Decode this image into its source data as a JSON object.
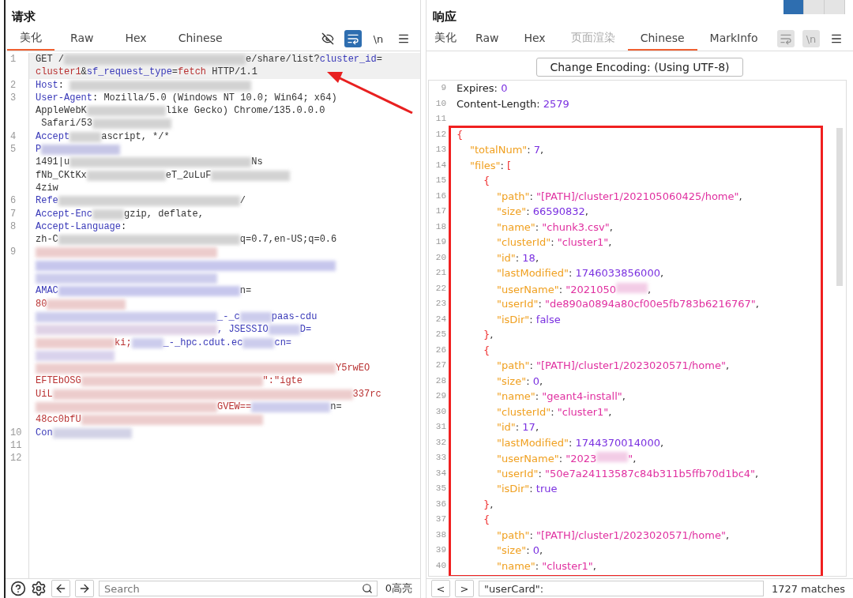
{
  "request": {
    "title": "请求",
    "tabs": [
      {
        "label": "美化",
        "selected": true,
        "disabled": false
      },
      {
        "label": "Raw",
        "selected": false,
        "disabled": false
      },
      {
        "label": "Hex",
        "selected": false,
        "disabled": false
      },
      {
        "label": "Chinese",
        "selected": false,
        "disabled": false
      }
    ],
    "toolbar": {
      "hide_on": false,
      "wrap_on": true,
      "newline_label": "\\n",
      "newline_on": false
    },
    "rows": [
      {
        "no": "1",
        "current": true,
        "segs": [
          {
            "kind": "plain",
            "text": "GET /"
          },
          {
            "kind": "blur-long",
            "color": "#c8c8c8"
          },
          {
            "kind": "plain",
            "text": "e/share/list?"
          },
          {
            "kind": "key",
            "text": "cluster_id"
          },
          {
            "kind": "plain",
            "text": "="
          }
        ]
      },
      {
        "current": true,
        "segs": [
          {
            "kind": "val",
            "text": "cluster1"
          },
          {
            "kind": "plain",
            "text": "&"
          },
          {
            "kind": "key",
            "text": "sf_request_type"
          },
          {
            "kind": "plain",
            "text": "="
          },
          {
            "kind": "val",
            "text": "fetch"
          },
          {
            "kind": "plain",
            "text": " HTTP/1.1"
          }
        ]
      },
      {
        "no": "2",
        "current": false,
        "segs": [
          {
            "kind": "key",
            "text": "Host"
          },
          {
            "kind": "plain",
            "text": ": "
          },
          {
            "kind": "blur-long",
            "color": "#c8c8c8"
          }
        ]
      },
      {
        "no": "3",
        "current": false,
        "segs": [
          {
            "kind": "key",
            "text": "User-Agent"
          },
          {
            "kind": "plain",
            "text": ": Mozilla/5.0 (Windows NT 10.0; Win64; x64)"
          }
        ]
      },
      {
        "current": false,
        "segs": [
          {
            "kind": "plain",
            "text": "AppleWebK"
          },
          {
            "kind": "blur-medium",
            "color": "#c8c8c8"
          },
          {
            "kind": "plain",
            "text": "like Gecko) Chrome/135.0.0.0"
          }
        ]
      },
      {
        "current": false,
        "segs": [
          {
            "kind": "plain",
            "text": " Safari/53"
          },
          {
            "kind": "blur-medium",
            "color": "#c8c8c8"
          }
        ]
      },
      {
        "no": "4",
        "current": false,
        "segs": [
          {
            "kind": "key",
            "text": "Accept"
          },
          {
            "kind": "blur-short",
            "color": "#c8c8c8"
          },
          {
            "kind": "plain",
            "text": "ascript, */*"
          }
        ]
      },
      {
        "no": "5",
        "current": false,
        "segs": [
          {
            "kind": "key",
            "text": "P"
          },
          {
            "kind": "blur-medium",
            "color": "#b8b8e0"
          }
        ]
      },
      {
        "current": false,
        "segs": [
          {
            "kind": "plain",
            "text": "1491|u"
          },
          {
            "kind": "blur-long",
            "color": "#c8c8c8"
          },
          {
            "kind": "plain",
            "text": "Ns"
          }
        ]
      },
      {
        "current": false,
        "segs": [
          {
            "kind": "plain",
            "text": "fNb_CKtKx"
          },
          {
            "kind": "blur-medium",
            "color": "#c8c8c8"
          },
          {
            "kind": "plain",
            "text": "eT_2uLuF"
          },
          {
            "kind": "blur-medium",
            "color": "#c8c8c8"
          }
        ]
      },
      {
        "current": false,
        "segs": [
          {
            "kind": "plain",
            "text": "4ziw"
          }
        ]
      },
      {
        "no": "6",
        "current": false,
        "segs": [
          {
            "kind": "key",
            "text": "Refe"
          },
          {
            "kind": "blur-long",
            "color": "#c8c8c8"
          },
          {
            "kind": "plain",
            "text": "/"
          }
        ]
      },
      {
        "no": "7",
        "current": false,
        "segs": [
          {
            "kind": "key",
            "text": "Accept-Enc"
          },
          {
            "kind": "blur-short",
            "color": "#c8c8c8"
          },
          {
            "kind": "plain",
            "text": "gzip, deflate,"
          }
        ]
      },
      {
        "no": "8",
        "current": false,
        "segs": [
          {
            "kind": "key",
            "text": "Accept-Language"
          },
          {
            "kind": "plain",
            "text": ":"
          }
        ]
      },
      {
        "current": false,
        "segs": [
          {
            "kind": "plain",
            "text": "zh-C"
          },
          {
            "kind": "blur-long",
            "color": "#c8c8c8"
          },
          {
            "kind": "plain",
            "text": "q=0.7,en-US;q=0.6"
          }
        ]
      },
      {
        "no": "9",
        "current": false,
        "segs": [
          {
            "kind": "blur-long",
            "color": "#e8c0c0"
          }
        ]
      },
      {
        "current": false,
        "segs": [
          {
            "kind": "blur-full",
            "color": "#b8b8e8"
          }
        ]
      },
      {
        "current": false,
        "segs": [
          {
            "kind": "blur-long",
            "color": "#c0c0e8"
          }
        ]
      },
      {
        "current": false,
        "segs": [
          {
            "kind": "key",
            "text": "AMAC"
          },
          {
            "kind": "blur-long",
            "color": "#b8b8e8"
          },
          {
            "kind": "plain",
            "text": "n="
          }
        ]
      },
      {
        "current": false,
        "segs": [
          {
            "kind": "val",
            "text": "80"
          },
          {
            "kind": "blur-medium",
            "color": "#e8c0c0"
          }
        ]
      },
      {
        "current": false,
        "segs": [
          {
            "kind": "blur-long",
            "color": "#c0c0e8"
          },
          {
            "kind": "key",
            "text": "_-_c"
          },
          {
            "kind": "blur-short",
            "color": "#c0c0e8"
          },
          {
            "kind": "key",
            "text": "paas-cdu"
          }
        ]
      },
      {
        "current": false,
        "segs": [
          {
            "kind": "blur-long",
            "color": "#d8c8e0"
          },
          {
            "kind": "key",
            "text": ", JSESSIO"
          },
          {
            "kind": "blur-short",
            "color": "#c0c0e8"
          },
          {
            "kind": "key",
            "text": "D="
          }
        ]
      },
      {
        "current": false,
        "segs": [
          {
            "kind": "blur-medium",
            "color": "#e8c0c0"
          },
          {
            "kind": "val",
            "text": "ki;"
          },
          {
            "kind": "blur-short",
            "color": "#c0c0e8"
          },
          {
            "kind": "key",
            "text": "_-_hpc.cdut.ec"
          },
          {
            "kind": "blur-short",
            "color": "#c0c0e8"
          },
          {
            "kind": "key",
            "text": "cn="
          }
        ]
      },
      {
        "current": false,
        "segs": [
          {
            "kind": "blur-medium",
            "color": "#d0c8e8"
          }
        ]
      },
      {
        "current": false,
        "segs": [
          {
            "kind": "blur-full",
            "color": "#e8c0c0"
          },
          {
            "kind": "val",
            "text": "Y5rwEO"
          }
        ]
      },
      {
        "current": false,
        "segs": [
          {
            "kind": "val",
            "text": "EFTEbOSG"
          },
          {
            "kind": "blur-long",
            "color": "#e8c0c0"
          },
          {
            "kind": "val",
            "text": "\":\"igte"
          }
        ]
      },
      {
        "current": false,
        "segs": [
          {
            "kind": "val",
            "text": "UiL"
          },
          {
            "kind": "blur-full",
            "color": "#e8c0c0"
          },
          {
            "kind": "val",
            "text": "337rc"
          }
        ]
      },
      {
        "current": false,
        "segs": [
          {
            "kind": "blur-long",
            "color": "#e8c0c0"
          },
          {
            "kind": "val",
            "text": "GVEW=="
          },
          {
            "kind": "blur-medium",
            "color": "#c0c0e8"
          },
          {
            "kind": "plain",
            "text": "n="
          }
        ]
      },
      {
        "current": false,
        "segs": [
          {
            "kind": "val",
            "text": "48cc0bfU"
          },
          {
            "kind": "blur-long",
            "color": "#e8c0c0"
          }
        ]
      },
      {
        "no": "10",
        "current": false,
        "segs": [
          {
            "kind": "key",
            "text": "Con"
          },
          {
            "kind": "blur-medium",
            "color": "#c8c8e0"
          }
        ]
      },
      {
        "no": "11",
        "current": false
      },
      {
        "no": "12",
        "current": false
      }
    ],
    "bottom": {
      "search_placeholder": "Search",
      "highlights": "0高亮"
    }
  },
  "response": {
    "title": "响应",
    "layout_buttons": [
      {
        "selected": true
      },
      {
        "selected": false
      },
      {
        "selected": false
      }
    ],
    "tabs": [
      {
        "label": "美化",
        "selected": false,
        "disabled": false
      },
      {
        "label": "Raw",
        "selected": false,
        "disabled": false
      },
      {
        "label": "Hex",
        "selected": false,
        "disabled": false
      },
      {
        "label": "页面渲染",
        "selected": false,
        "disabled": true
      },
      {
        "label": "Chinese",
        "selected": true,
        "disabled": false
      },
      {
        "label": "MarkInfo",
        "selected": false,
        "disabled": false
      }
    ],
    "toolbar": {
      "newline_label": "\\n"
    },
    "encoding_button": "Change Encoding: (Using UTF-8)",
    "lines": [
      {
        "no": "9",
        "segs": [
          {
            "kind": "header",
            "text": "Expires: "
          },
          {
            "kind": "num",
            "text": "0"
          }
        ]
      },
      {
        "no": "10",
        "segs": [
          {
            "kind": "header",
            "text": "Content-Length: "
          },
          {
            "kind": "num",
            "text": "2579"
          }
        ]
      },
      {
        "no": "11"
      },
      {
        "no": "12",
        "segs": [
          {
            "kind": "punct",
            "text": "{"
          }
        ],
        "children": [
          {
            "no": "13",
            "segs": [
              {
                "kind": "key",
                "text": "\"totalNum\""
              },
              {
                "kind": "plain",
                "text": ": "
              },
              {
                "kind": "num",
                "text": "7"
              },
              {
                "kind": "plain",
                "text": ","
              }
            ]
          },
          {
            "no": "14",
            "segs": [
              {
                "kind": "key",
                "text": "\"files\""
              },
              {
                "kind": "plain",
                "text": ": "
              },
              {
                "kind": "punct",
                "text": "["
              }
            ],
            "children": [
              {
                "no": "15",
                "segs": [
                  {
                    "kind": "punct",
                    "text": "{"
                  }
                ],
                "children": [
                  {
                    "no": "16",
                    "segs": [
                      {
                        "kind": "key",
                        "text": "\"path\""
                      },
                      {
                        "kind": "plain",
                        "text": ": "
                      },
                      {
                        "kind": "str",
                        "text": "\"[PATH]/cluster1/202105060425/home\""
                      },
                      {
                        "kind": "plain",
                        "text": ","
                      }
                    ]
                  },
                  {
                    "no": "17",
                    "segs": [
                      {
                        "kind": "key",
                        "text": "\"size\""
                      },
                      {
                        "kind": "plain",
                        "text": ": "
                      },
                      {
                        "kind": "num",
                        "text": "66590832"
                      },
                      {
                        "kind": "plain",
                        "text": ","
                      }
                    ]
                  },
                  {
                    "no": "18",
                    "segs": [
                      {
                        "kind": "key",
                        "text": "\"name\""
                      },
                      {
                        "kind": "plain",
                        "text": ": "
                      },
                      {
                        "kind": "str",
                        "text": "\"chunk3.csv\""
                      },
                      {
                        "kind": "plain",
                        "text": ","
                      }
                    ]
                  },
                  {
                    "no": "19",
                    "segs": [
                      {
                        "kind": "key",
                        "text": "\"clusterId\""
                      },
                      {
                        "kind": "plain",
                        "text": ": "
                      },
                      {
                        "kind": "str",
                        "text": "\"cluster1\""
                      },
                      {
                        "kind": "plain",
                        "text": ","
                      }
                    ]
                  },
                  {
                    "no": "20",
                    "segs": [
                      {
                        "kind": "key",
                        "text": "\"id\""
                      },
                      {
                        "kind": "plain",
                        "text": ": "
                      },
                      {
                        "kind": "num",
                        "text": "18"
                      },
                      {
                        "kind": "plain",
                        "text": ","
                      }
                    ]
                  },
                  {
                    "no": "21",
                    "segs": [
                      {
                        "kind": "key",
                        "text": "\"lastModified\""
                      },
                      {
                        "kind": "plain",
                        "text": ": "
                      },
                      {
                        "kind": "num",
                        "text": "1746033856000"
                      },
                      {
                        "kind": "plain",
                        "text": ","
                      }
                    ]
                  },
                  {
                    "no": "22",
                    "segs": [
                      {
                        "kind": "key",
                        "text": "\"userName\""
                      },
                      {
                        "kind": "plain",
                        "text": ": "
                      },
                      {
                        "kind": "str",
                        "text": "\"2021050"
                      },
                      {
                        "kind": "blur-short",
                        "color": "#f0c0e0"
                      },
                      {
                        "kind": "plain",
                        "text": ","
                      }
                    ]
                  },
                  {
                    "no": "23",
                    "segs": [
                      {
                        "kind": "key",
                        "text": "\"userId\""
                      },
                      {
                        "kind": "plain",
                        "text": ": "
                      },
                      {
                        "kind": "str",
                        "text": "\"de890a0894a80cf00e5fb783b6216767\""
                      },
                      {
                        "kind": "plain",
                        "text": ","
                      }
                    ]
                  },
                  {
                    "no": "24",
                    "segs": [
                      {
                        "kind": "key",
                        "text": "\"isDir\""
                      },
                      {
                        "kind": "plain",
                        "text": ": "
                      },
                      {
                        "kind": "num",
                        "text": "false"
                      }
                    ]
                  }
                ]
              },
              {
                "no": "25",
                "segs": [
                  {
                    "kind": "punct",
                    "text": "}"
                  },
                  {
                    "kind": "plain",
                    "text": ","
                  }
                ]
              },
              {
                "no": "26",
                "segs": [
                  {
                    "kind": "punct",
                    "text": "{"
                  }
                ],
                "children": [
                  {
                    "no": "27",
                    "segs": [
                      {
                        "kind": "key",
                        "text": "\"path\""
                      },
                      {
                        "kind": "plain",
                        "text": ": "
                      },
                      {
                        "kind": "str",
                        "text": "\"[PATH]/cluster1/2023020571/home\""
                      },
                      {
                        "kind": "plain",
                        "text": ","
                      }
                    ]
                  },
                  {
                    "no": "28",
                    "segs": [
                      {
                        "kind": "key",
                        "text": "\"size\""
                      },
                      {
                        "kind": "plain",
                        "text": ": "
                      },
                      {
                        "kind": "num",
                        "text": "0"
                      },
                      {
                        "kind": "plain",
                        "text": ","
                      }
                    ]
                  },
                  {
                    "no": "29",
                    "segs": [
                      {
                        "kind": "key",
                        "text": "\"name\""
                      },
                      {
                        "kind": "plain",
                        "text": ": "
                      },
                      {
                        "kind": "str",
                        "text": "\"geant4-install\""
                      },
                      {
                        "kind": "plain",
                        "text": ","
                      }
                    ]
                  },
                  {
                    "no": "30",
                    "segs": [
                      {
                        "kind": "key",
                        "text": "\"clusterId\""
                      },
                      {
                        "kind": "plain",
                        "text": ": "
                      },
                      {
                        "kind": "str",
                        "text": "\"cluster1\""
                      },
                      {
                        "kind": "plain",
                        "text": ","
                      }
                    ]
                  },
                  {
                    "no": "31",
                    "segs": [
                      {
                        "kind": "key",
                        "text": "\"id\""
                      },
                      {
                        "kind": "plain",
                        "text": ": "
                      },
                      {
                        "kind": "num",
                        "text": "17"
                      },
                      {
                        "kind": "plain",
                        "text": ","
                      }
                    ]
                  },
                  {
                    "no": "32",
                    "segs": [
                      {
                        "kind": "key",
                        "text": "\"lastModified\""
                      },
                      {
                        "kind": "plain",
                        "text": ": "
                      },
                      {
                        "kind": "num",
                        "text": "1744370014000"
                      },
                      {
                        "kind": "plain",
                        "text": ","
                      }
                    ]
                  },
                  {
                    "no": "33",
                    "segs": [
                      {
                        "kind": "key",
                        "text": "\"userName\""
                      },
                      {
                        "kind": "plain",
                        "text": ": "
                      },
                      {
                        "kind": "str",
                        "text": "\"2023"
                      },
                      {
                        "kind": "blur-short",
                        "color": "#f0c0e0"
                      },
                      {
                        "kind": "str",
                        "text": "\""
                      },
                      {
                        "kind": "plain",
                        "text": ","
                      }
                    ]
                  },
                  {
                    "no": "34",
                    "segs": [
                      {
                        "kind": "key",
                        "text": "\"userId\""
                      },
                      {
                        "kind": "plain",
                        "text": ": "
                      },
                      {
                        "kind": "str",
                        "text": "\"50e7a24113587c84b311b5ffb70d1bc4\""
                      },
                      {
                        "kind": "plain",
                        "text": ","
                      }
                    ]
                  },
                  {
                    "no": "35",
                    "segs": [
                      {
                        "kind": "key",
                        "text": "\"isDir\""
                      },
                      {
                        "kind": "plain",
                        "text": ": "
                      },
                      {
                        "kind": "num",
                        "text": "true"
                      }
                    ]
                  }
                ]
              },
              {
                "no": "36",
                "segs": [
                  {
                    "kind": "punct",
                    "text": "}"
                  },
                  {
                    "kind": "plain",
                    "text": ","
                  }
                ]
              },
              {
                "no": "37",
                "segs": [
                  {
                    "kind": "punct",
                    "text": "{"
                  }
                ],
                "children": [
                  {
                    "no": "38",
                    "segs": [
                      {
                        "kind": "key",
                        "text": "\"path\""
                      },
                      {
                        "kind": "plain",
                        "text": ": "
                      },
                      {
                        "kind": "str",
                        "text": "\"[PATH]/cluster1/2023020571/home\""
                      },
                      {
                        "kind": "plain",
                        "text": ","
                      }
                    ]
                  },
                  {
                    "no": "39",
                    "segs": [
                      {
                        "kind": "key",
                        "text": "\"size\""
                      },
                      {
                        "kind": "plain",
                        "text": ": "
                      },
                      {
                        "kind": "num",
                        "text": "0"
                      },
                      {
                        "kind": "plain",
                        "text": ","
                      }
                    ]
                  },
                  {
                    "no": "40",
                    "segs": [
                      {
                        "kind": "key",
                        "text": "\"name\""
                      },
                      {
                        "kind": "plain",
                        "text": ": "
                      },
                      {
                        "kind": "str",
                        "text": "\"cluster1\""
                      },
                      {
                        "kind": "plain",
                        "text": ","
                      }
                    ]
                  }
                ]
              }
            ]
          }
        ]
      }
    ],
    "bottom": {
      "prev": "<",
      "next": ">",
      "search_value": "\"userCard\":",
      "matches": "1727 matches"
    }
  }
}
